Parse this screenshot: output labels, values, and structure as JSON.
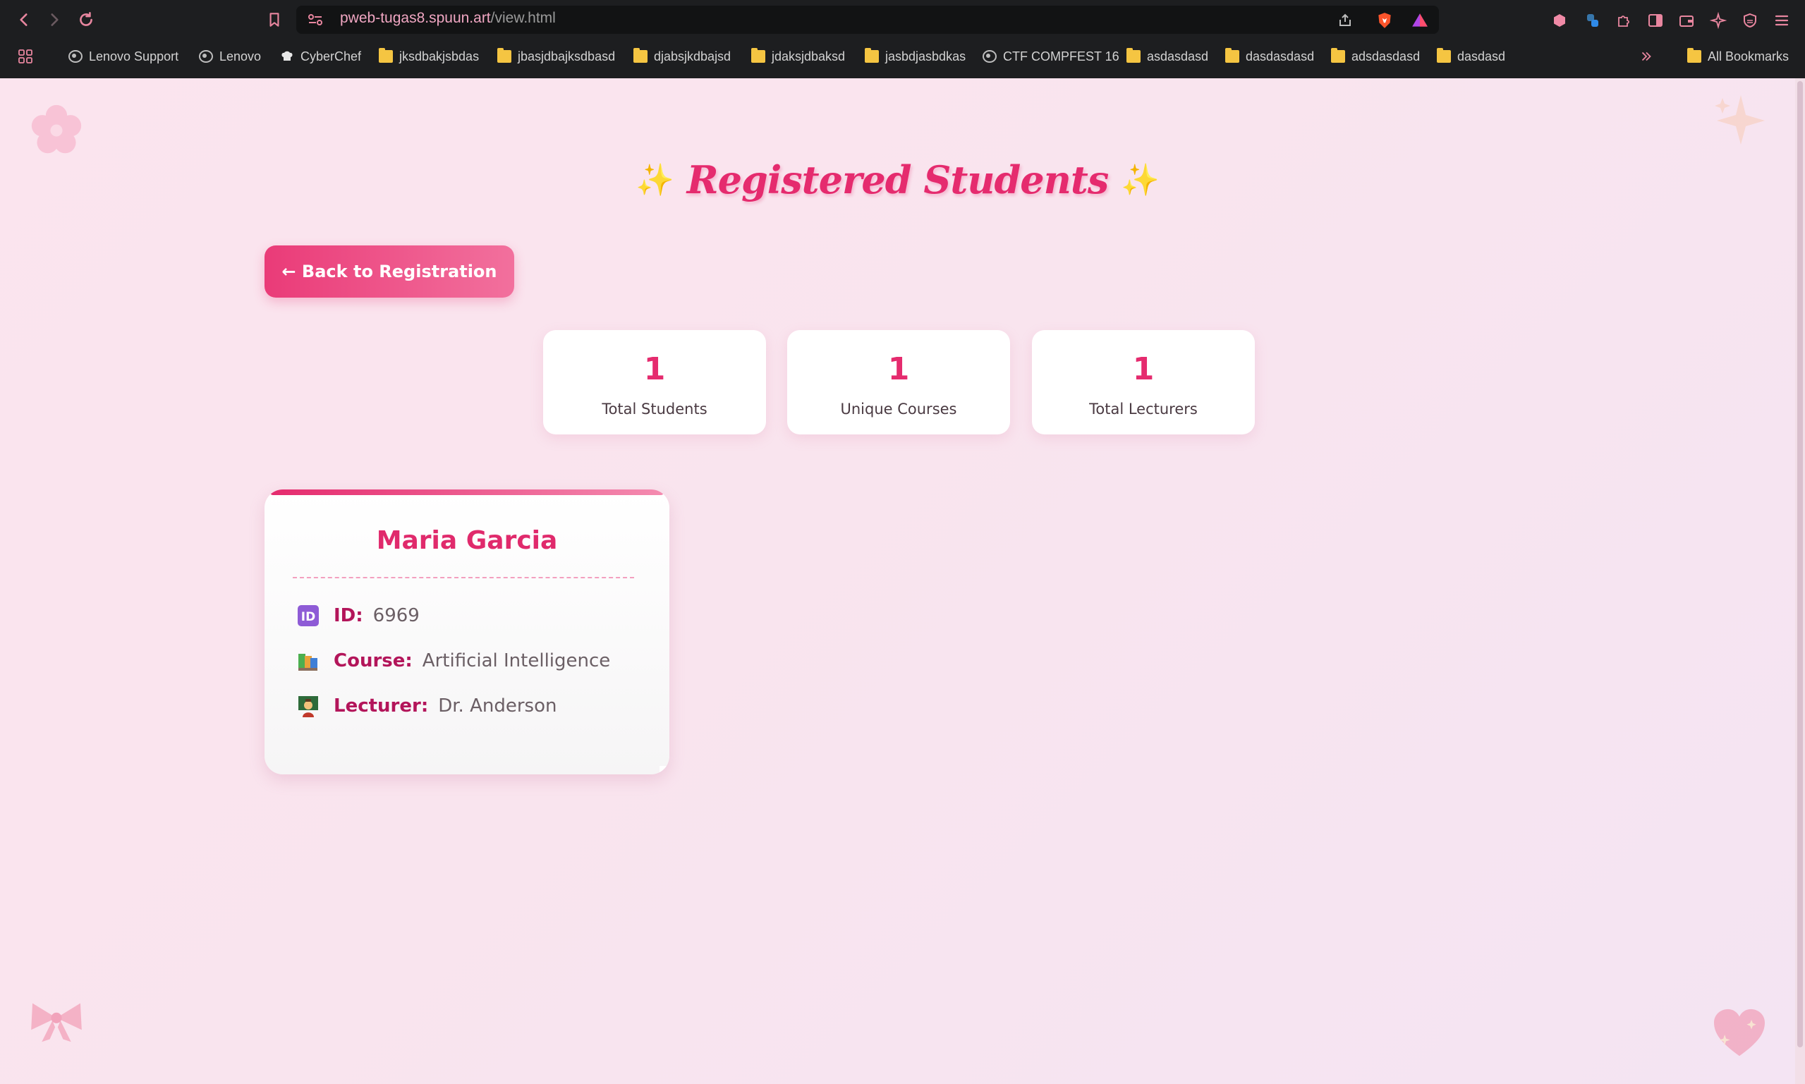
{
  "browser": {
    "url_host": "pweb-tugas8.spuun.art",
    "url_path": "/view.html",
    "bookmarks": [
      {
        "label": "Lenovo Support",
        "icon": "globe-icon"
      },
      {
        "label": "Lenovo",
        "icon": "globe-icon"
      },
      {
        "label": "CyberChef",
        "icon": "chef-hat-icon"
      },
      {
        "label": "jksdbakjsbdas",
        "icon": "folder-icon"
      },
      {
        "label": "jbasjdbajksdbasd",
        "icon": "folder-icon"
      },
      {
        "label": "djabsjkdbajsd",
        "icon": "folder-icon"
      },
      {
        "label": "jdaksjdbaksd",
        "icon": "folder-icon"
      },
      {
        "label": "jasbdjasbdkas",
        "icon": "folder-icon"
      },
      {
        "label": "CTF COMPFEST 16",
        "icon": "globe-icon"
      },
      {
        "label": "asdasdasd",
        "icon": "folder-icon"
      },
      {
        "label": "dasdasdasd",
        "icon": "folder-icon"
      },
      {
        "label": "adsdasdasd",
        "icon": "folder-icon"
      },
      {
        "label": "dasdasd",
        "icon": "folder-icon"
      }
    ],
    "all_bookmarks": "All Bookmarks"
  },
  "page": {
    "title_spark": "✨",
    "title": "Registered Students",
    "back_button": "← Back to Registration",
    "stats": [
      {
        "value": "1",
        "label": "Total Students"
      },
      {
        "value": "1",
        "label": "Unique Courses"
      },
      {
        "value": "1",
        "label": "Total Lecturers"
      }
    ],
    "student": {
      "name": "Maria Garcia",
      "rows": [
        {
          "icon": "id-icon",
          "label": "ID:",
          "value": "6969"
        },
        {
          "icon": "books-icon",
          "label": "Course:",
          "value": "Artificial Intelligence"
        },
        {
          "icon": "teacher-icon",
          "label": "Lecturer:",
          "value": "Dr. Anderson"
        }
      ]
    }
  },
  "colors": {
    "accent": "#e52b6e",
    "background": "#fbe4ee",
    "label": "#b3155a"
  }
}
